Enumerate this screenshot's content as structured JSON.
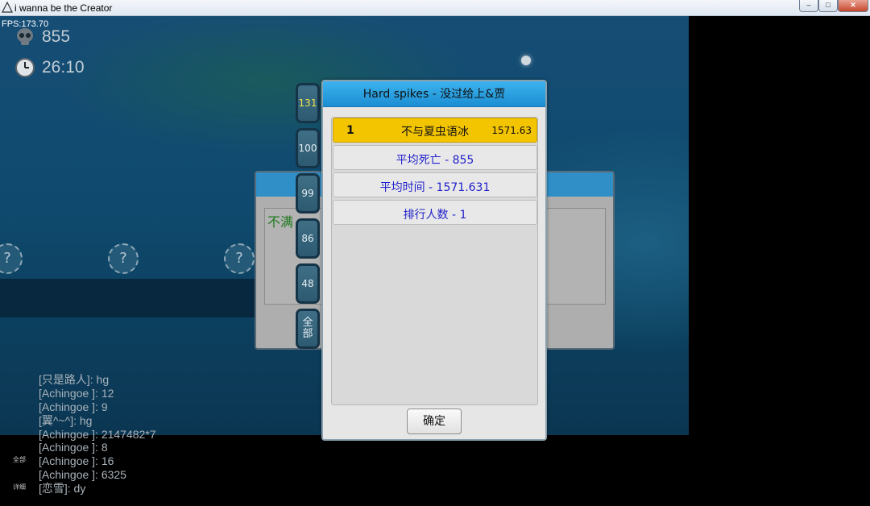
{
  "window": {
    "title": "i wanna be the Creator",
    "icon": "triangle-icon"
  },
  "hud": {
    "fps": "FPS:173.70",
    "deaths": "855",
    "time": "26:10",
    "death_icon": "skull-icon",
    "time_icon": "clock-icon"
  },
  "background_dialog": {
    "text": "不满"
  },
  "tabs": [
    {
      "label": "131",
      "active": true
    },
    {
      "label": "100"
    },
    {
      "label": "99"
    },
    {
      "label": "86"
    },
    {
      "label": "48"
    },
    {
      "label_top": "全",
      "label_bottom": "部"
    }
  ],
  "dialog": {
    "title": "Hard spikes - 没过给上&贾",
    "top_entry": {
      "rank": "1",
      "name": "不与夏虫语冰",
      "score": "1571.63"
    },
    "stats": [
      "平均死亡 - 855",
      "平均时间 - 1571.631",
      "排行人数 - 1"
    ],
    "ok_label": "确定"
  },
  "chat": [
    "[只是路人]: hg",
    "[Achingoe ]: 12",
    "[Achingoe ]: 9",
    "[翼^~^]: hg",
    "[Achingoe ]: 2147482*7",
    "[Achingoe ]: 8",
    "[Achingoe ]: 16",
    "[Achingoe ]: 6325",
    "[恋雪]: dy"
  ],
  "chat_filters": {
    "all": "全部",
    "detail": "详细"
  },
  "colors": {
    "title_bar": "#1b8ed2",
    "gold_row": "#f3c400",
    "stat_text": "#2222cc",
    "active_tab": "#f2e24a"
  }
}
